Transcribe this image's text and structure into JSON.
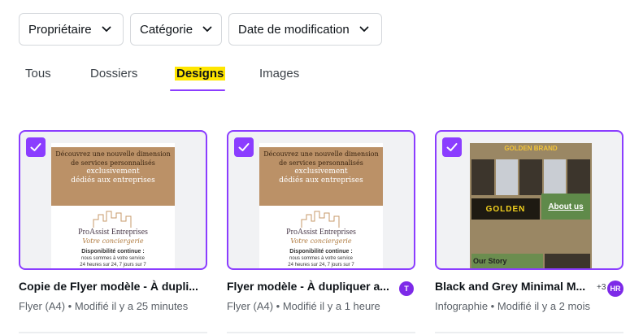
{
  "filters": [
    {
      "label": "Propriétaire"
    },
    {
      "label": "Catégorie"
    },
    {
      "label": "Date de modification"
    }
  ],
  "tabs": [
    {
      "label": "Tous",
      "active": false
    },
    {
      "label": "Dossiers",
      "active": false
    },
    {
      "label": "Designs",
      "active": true
    },
    {
      "label": "Images",
      "active": false
    }
  ],
  "colors": {
    "accent": "#8b3dff",
    "highlight": "#ffe600"
  },
  "cards": [
    {
      "title": "Copie de Flyer modèle - À dupli...",
      "meta": "Flyer (A4) • Modifié il y a 25 minutes",
      "selected": true,
      "thumb": {
        "line1": "Découvrez une nouvelle dimension",
        "line2": "de services personnalisés",
        "line3": "exclusivement",
        "line4": "dédiés aux entreprises",
        "brand": "ProAssist Entreprises",
        "sub": "Votre conciergerie",
        "small1": "Disponibilité continue :",
        "small2": "nous sommes à votre service",
        "small3": "24 heures sur 24, 7 jours sur 7"
      }
    },
    {
      "title": "Flyer modèle - À dupliquer a...",
      "meta": "Flyer (A4) • Modifié il y a 1 heure",
      "selected": true,
      "avatar": "T",
      "thumb": {
        "line1": "Découvrez une nouvelle dimension",
        "line2": "de services personnalisés",
        "line3": "exclusivement",
        "line4": "dédiés aux entreprises",
        "brand": "ProAssist Entreprises",
        "sub": "Votre conciergerie",
        "small1": "Disponibilité continue :",
        "small2": "nous sommes à votre service",
        "small3": "24 heures sur 24, 7 jours sur 7"
      }
    },
    {
      "title": "Black and Grey Minimal M...",
      "meta": "Infographie • Modifié il y a 2 mois",
      "selected": true,
      "collaborators_extra": "+3",
      "avatar": "HR",
      "thumb": {
        "header": "GOLDEN BRAND",
        "golden": "GOLDEN",
        "about": "About us",
        "story": "Our Story"
      }
    }
  ]
}
